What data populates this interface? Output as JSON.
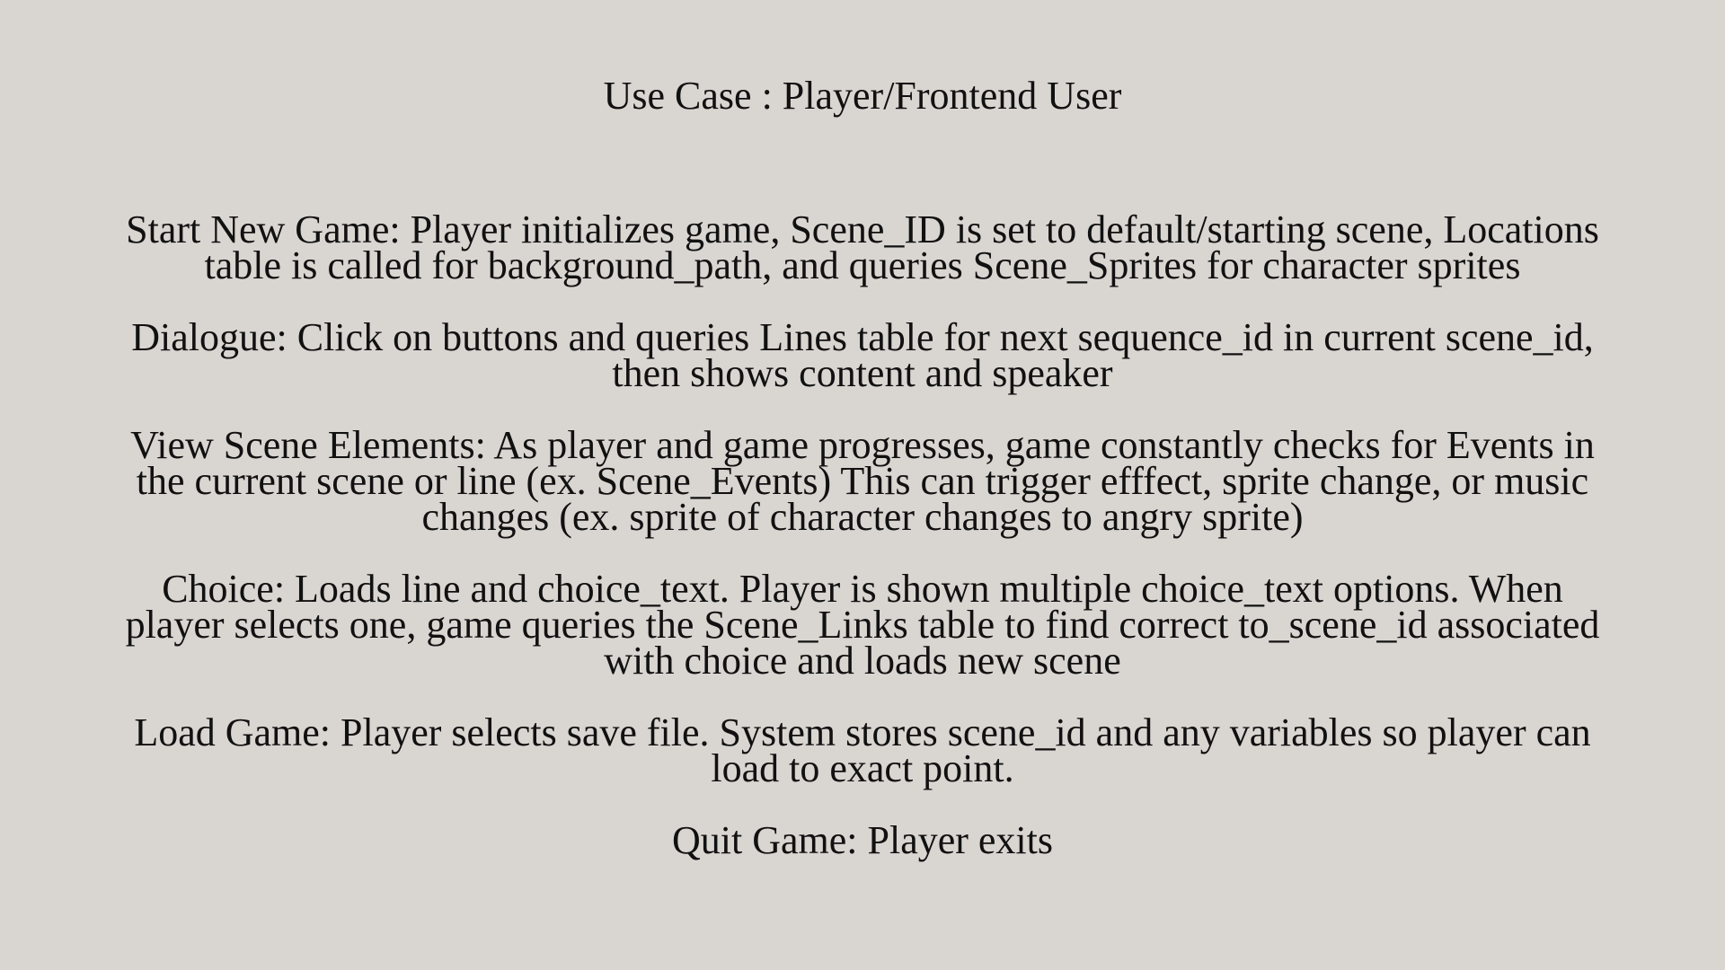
{
  "document": {
    "title": "Use Case : Player/Frontend User",
    "items": [
      {
        "text": "Start New Game: Player initializes game, Scene_ID is set to default/starting scene, Locations\ntable is called for background_path, and queries Scene_Sprites for character sprites"
      },
      {
        "text": "Dialogue: Click on buttons and queries Lines table for next sequence_id in current scene_id,\nthen shows content and speaker"
      },
      {
        "text": "View Scene Elements: As player and game progresses, game constantly checks for Events in\nthe current scene or line (ex. Scene_Events) This can trigger efffect, sprite change, or music\nchanges (ex. sprite of character changes to angry sprite)"
      },
      {
        "text": "Choice: Loads line and choice_text. Player is shown multiple choice_text options. When\nplayer selects one, game queries the Scene_Links table to find correct to_scene_id associated\nwith choice and loads new scene"
      },
      {
        "text": "Load Game: Player selects save file. System stores scene_id and any variables so player can\nload to exact point."
      },
      {
        "text": "Quit Game: Player exits"
      }
    ]
  }
}
